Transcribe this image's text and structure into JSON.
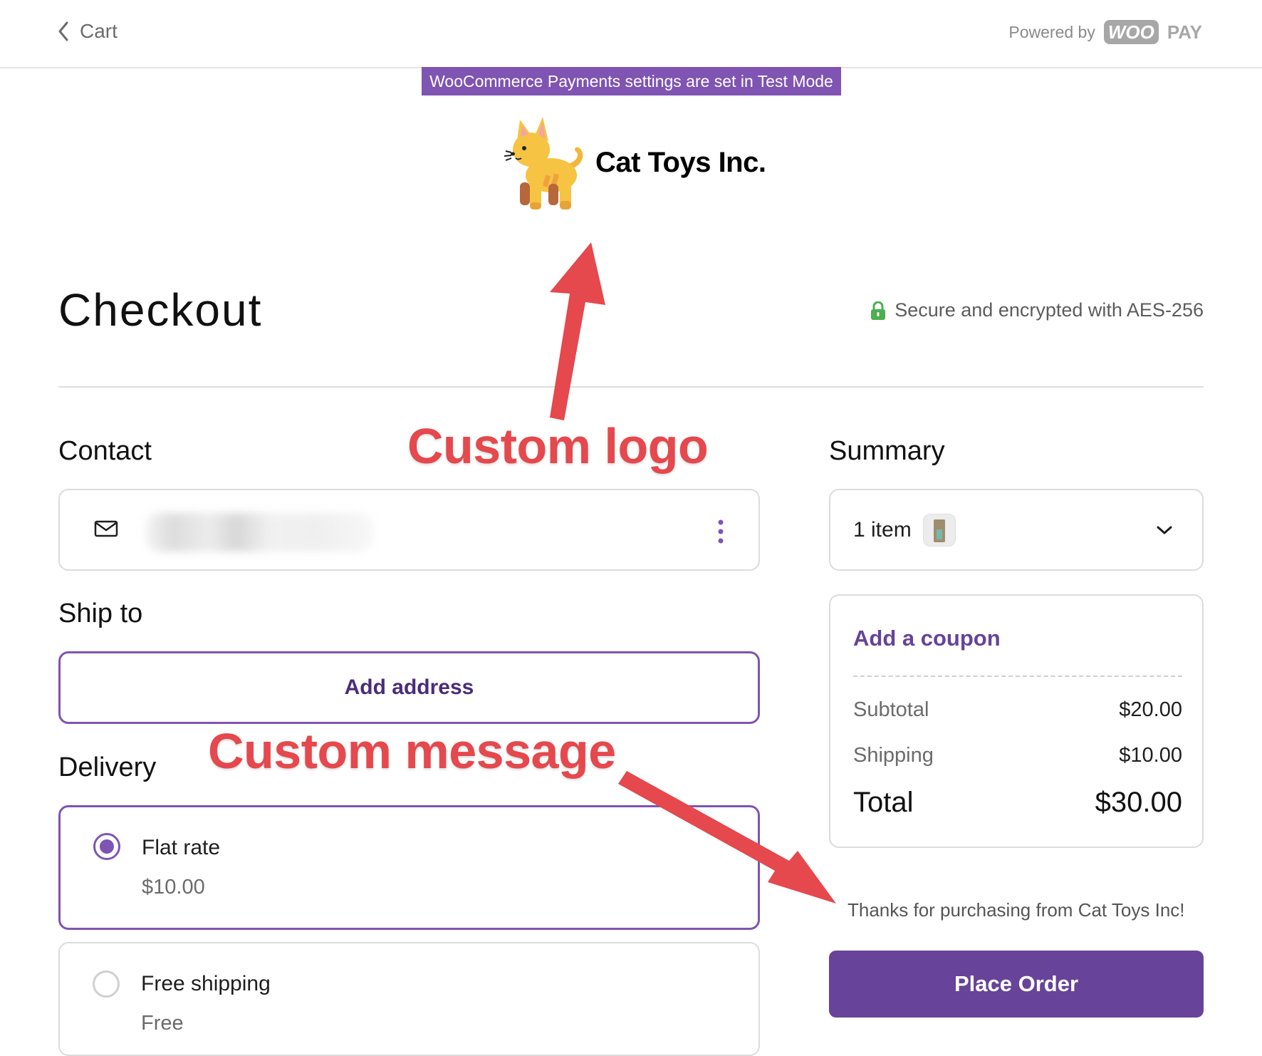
{
  "header": {
    "back_label": "Cart",
    "powered_by": "Powered by",
    "brand_woo": "WOO",
    "brand_pay": "PAY"
  },
  "notice": {
    "test_mode": "WooCommerce Payments settings are set in Test Mode"
  },
  "store": {
    "name": "Cat Toys Inc."
  },
  "checkout": {
    "title": "Checkout",
    "secure_text": "Secure and encrypted with AES-256"
  },
  "contact": {
    "heading": "Contact"
  },
  "ship_to": {
    "heading": "Ship to",
    "add_address_label": "Add address"
  },
  "delivery": {
    "heading": "Delivery",
    "options": [
      {
        "name": "Flat rate",
        "price": "$10.00",
        "selected": true
      },
      {
        "name": "Free shipping",
        "price": "Free",
        "selected": false
      }
    ]
  },
  "summary": {
    "heading": "Summary",
    "items_label": "1 item",
    "coupon_label": "Add a coupon",
    "rows": [
      {
        "label": "Subtotal",
        "value": "$20.00"
      },
      {
        "label": "Shipping",
        "value": "$10.00"
      }
    ],
    "total": {
      "label": "Total",
      "value": "$30.00"
    },
    "custom_message": "Thanks for purchasing from Cat Toys Inc!",
    "place_order_label": "Place Order"
  },
  "annotations": {
    "logo_label": "Custom logo",
    "message_label": "Custom message"
  },
  "colors": {
    "accent": "#7f54b3",
    "button": "#674399",
    "annotation": "#e5484d",
    "lock": "#4caf50"
  },
  "icons": [
    "chevron-left-icon",
    "mail-icon",
    "kebab-menu-icon",
    "lock-icon",
    "chevron-down-icon",
    "cat-logo-icon"
  ]
}
